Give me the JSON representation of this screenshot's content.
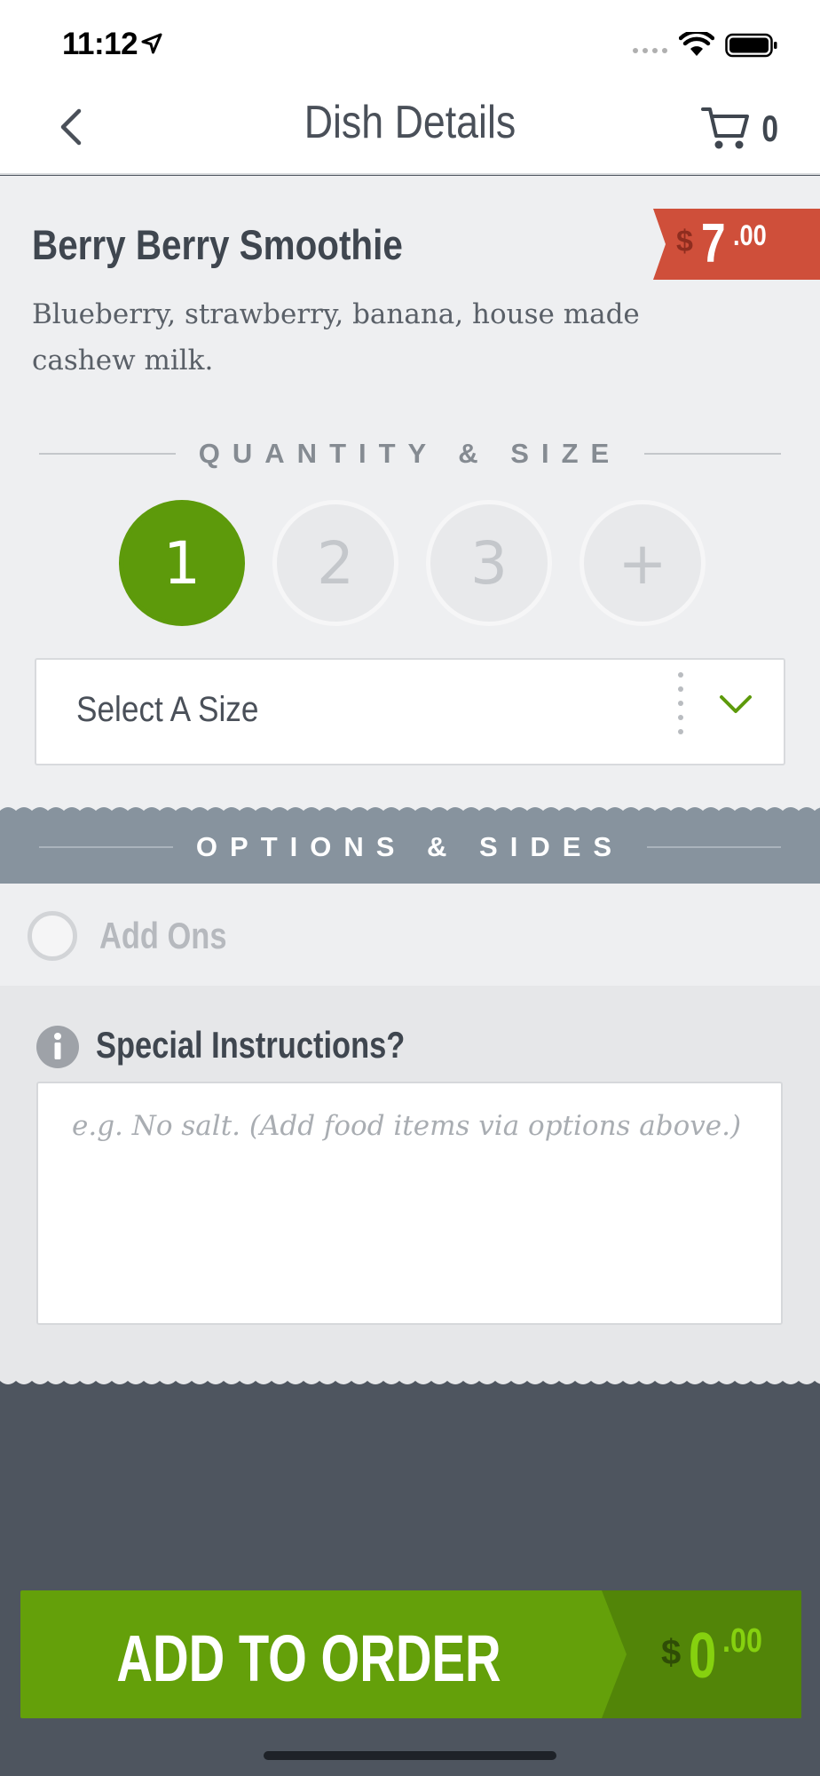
{
  "status_bar": {
    "time": "11:12"
  },
  "nav": {
    "title": "Dish Details",
    "cart_count": "0"
  },
  "dish": {
    "name": "Berry Berry Smoothie",
    "price": {
      "currency": "$",
      "whole": "7",
      "cents": ".00"
    },
    "description": "Blueberry, strawberry, banana, house made cashew milk."
  },
  "quantity": {
    "label": "QUANTITY & SIZE",
    "options": [
      "1",
      "2",
      "3",
      "+"
    ],
    "selected": "1"
  },
  "size_select": {
    "label": "Select A Size"
  },
  "options": {
    "label": "OPTIONS & SIDES",
    "addons_label": "Add Ons"
  },
  "instructions": {
    "title": "Special Instructions?",
    "placeholder": "e.g. No salt. (Add food items via options above.)"
  },
  "add_to_order": {
    "label": "ADD TO ORDER",
    "total": {
      "currency": "$",
      "whole": "0",
      "cents": ".00"
    }
  },
  "colors": {
    "accent_green": "#64a00a",
    "price_red": "#cf4f3a",
    "options_band": "#87939e",
    "footer": "#4e555f"
  }
}
